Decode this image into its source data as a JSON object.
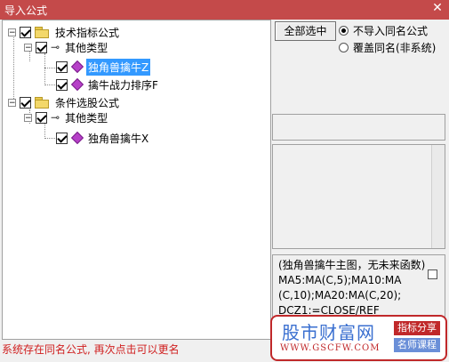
{
  "window": {
    "title": "导入公式",
    "close_glyph": "✕"
  },
  "tree": [
    {
      "label": "技术指标公式",
      "expander": "−",
      "checked": true
    },
    {
      "label": "其他类型",
      "expander": "−",
      "checked": true
    },
    {
      "label": "独角兽擒牛Z",
      "checked": true,
      "selected": true
    },
    {
      "label": "擒牛战力排序F",
      "checked": true
    },
    {
      "label": "条件选股公式",
      "expander": "−",
      "checked": true
    },
    {
      "label": "其他类型",
      "expander": "−",
      "checked": true
    },
    {
      "label": "独角兽擒牛X",
      "checked": true
    }
  ],
  "buttons": {
    "select_all": "全部选中"
  },
  "options": [
    {
      "label": "不导入同名公式",
      "selected": true
    },
    {
      "label": "覆盖同名(非系统)",
      "selected": false
    }
  ],
  "description": "(独角兽擒牛主图，无未来函数)\nMA5:MA(C,5);MA10:MA\n(C,10);MA20:MA(C,20);\nDCZ1:=CLOSE/REF",
  "status": "系统存在同名公式, 再次点击可以更名",
  "watermark": {
    "site_name": "股市财富网",
    "url": "WWW.GSCFW.COM",
    "tag1": "指标分享",
    "tag2": "名师课程"
  },
  "colors": {
    "titlebar": "#c44a4a",
    "selection": "#3399ff",
    "status_text": "#d02020",
    "watermark_border": "#c0282a"
  }
}
